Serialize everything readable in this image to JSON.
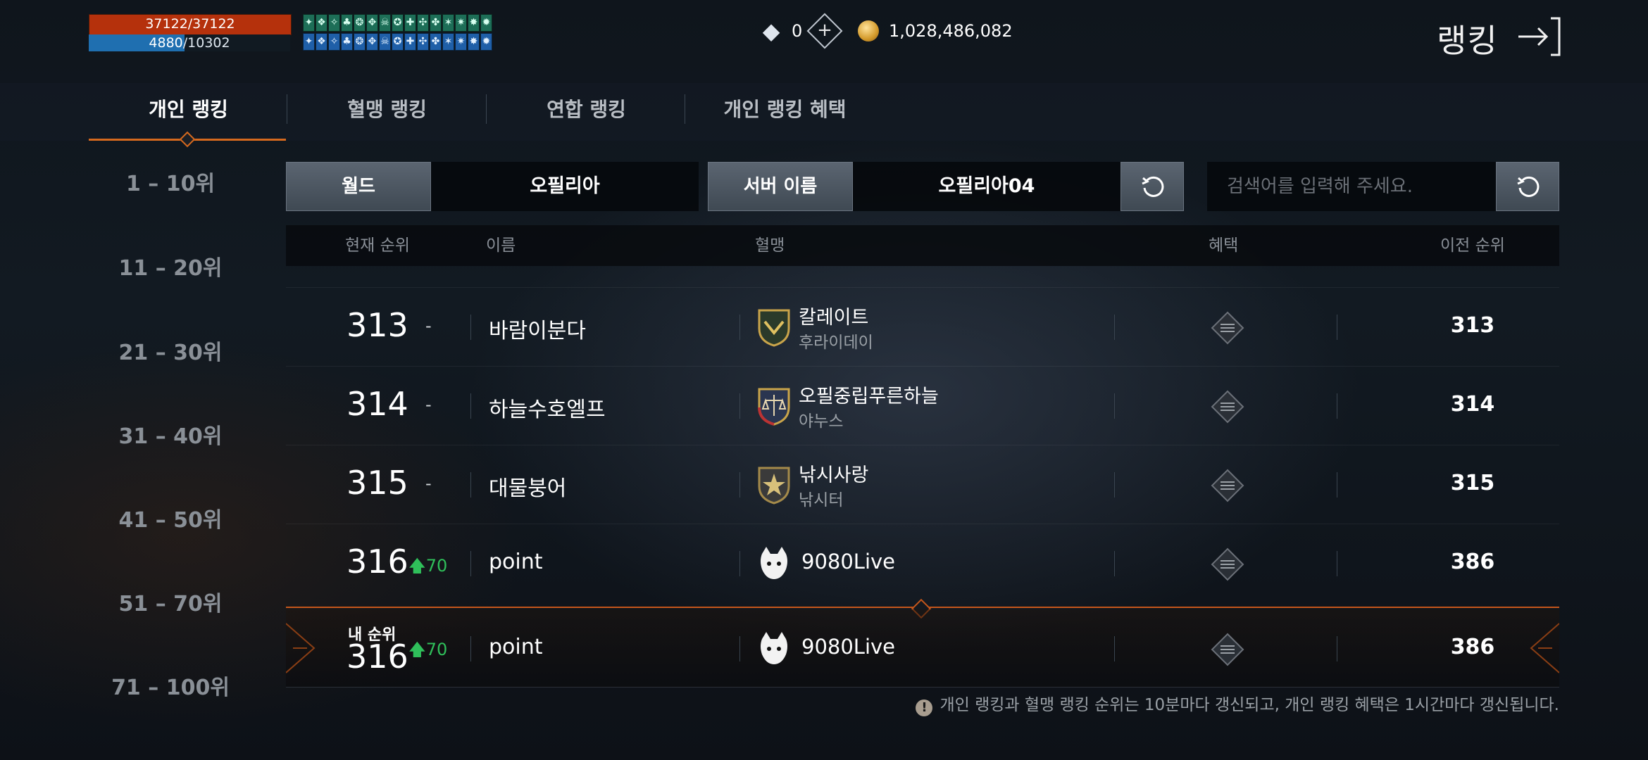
{
  "hud": {
    "hp_text": "37122/37122",
    "mp_text_current": "4880",
    "mp_text_max": "/10302",
    "hp_fraction": 1.0,
    "mp_fraction": 0.474,
    "buff_icons_row1": [
      "buff-icon",
      "buff-icon",
      "buff-icon",
      "buff-icon",
      "buff-icon",
      "buff-icon",
      "buff-icon",
      "buff-icon",
      "buff-icon",
      "buff-icon",
      "buff-icon",
      "buff-icon",
      "buff-icon",
      "buff-icon",
      "buff-icon"
    ],
    "buff_icons_row2": [
      "buff-icon",
      "buff-icon",
      "buff-icon",
      "buff-icon",
      "buff-icon",
      "buff-icon",
      "buff-icon",
      "buff-icon",
      "buff-icon",
      "buff-icon",
      "buff-icon",
      "buff-icon",
      "buff-icon",
      "buff-icon",
      "buff-icon"
    ]
  },
  "currency": {
    "diamond": "0",
    "gold": "1,028,486,082"
  },
  "header": {
    "title": "랭킹"
  },
  "tabs": [
    {
      "label": "개인 랭킹",
      "active": true
    },
    {
      "label": "혈맹 랭킹",
      "active": false
    },
    {
      "label": "연합 랭킹",
      "active": false
    },
    {
      "label": "개인 랭킹 혜택",
      "active": false
    }
  ],
  "ranges": [
    "1 – 10위",
    "11 – 20위",
    "21 – 30위",
    "31 – 40위",
    "41 – 50위",
    "51 – 70위",
    "71 – 100위"
  ],
  "filters": {
    "world_label": "월드",
    "world_value": "오필리아",
    "server_label": "서버 이름",
    "server_value": "오필리아04",
    "search_placeholder": "검색어를 입력해 주세요."
  },
  "table": {
    "headers": {
      "current_rank": "현재 순위",
      "name": "이름",
      "clan": "혈맹",
      "benefit": "혜택",
      "previous_rank": "이전 순위"
    },
    "rows": [
      {
        "rank": "313",
        "change": "-",
        "name": "바람이분다",
        "clan": "칼레이트",
        "clan_sub": "후라이데이",
        "prev": "313"
      },
      {
        "rank": "314",
        "change": "-",
        "name": "하늘수호엘프",
        "clan": "오필중립푸른하늘",
        "clan_sub": "야누스",
        "prev": "314"
      },
      {
        "rank": "315",
        "change": "-",
        "name": "대물붕어",
        "clan": "낚시사랑",
        "clan_sub": "낚시터",
        "prev": "315"
      },
      {
        "rank": "316",
        "change_up": "70",
        "name": "point",
        "clan": "9080Live",
        "prev": "386"
      }
    ],
    "my_rank": {
      "label": "내 순위",
      "rank": "316",
      "change_up": "70",
      "name": "point",
      "clan": "9080Live",
      "prev": "386"
    }
  },
  "notice": "개인 랭킹과 혈맹 랭킹 순위는 10분마다 갱신되고, 개인 랭킹 혜택은 1시간마다 갱신됩니다.",
  "colors": {
    "accent": "#d5691e",
    "hp": "#b5310c",
    "mp": "#1f6fb0",
    "rank_up": "#2fbf5a"
  }
}
